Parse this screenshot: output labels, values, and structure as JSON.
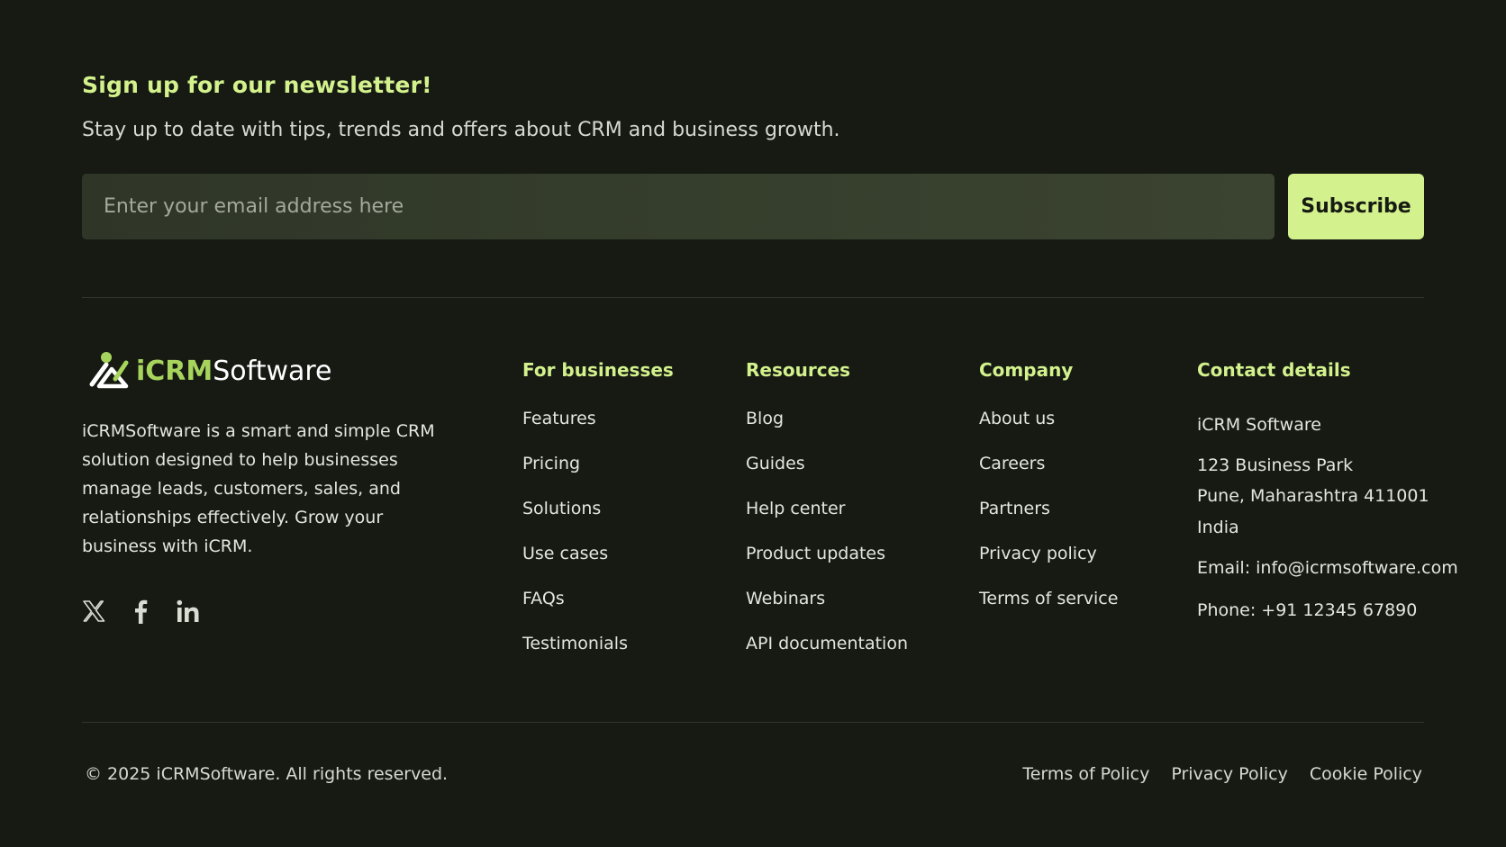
{
  "newsletter": {
    "title": "Sign up for our newsletter!",
    "subtitle": "Stay up to date with tips, trends and offers about CRM and business growth.",
    "email_placeholder": "Enter your email address here",
    "email_value": "",
    "subscribe_label": "Subscribe"
  },
  "brand": {
    "name_part1": "iCRM",
    "name_part2": "Software",
    "icon": "logo-mark-icon",
    "description": "iCRMSoftware is a smart and simple CRM solution designed to help businesses manage leads, customers, sales, and relationships effectively. Grow your business with iCRM."
  },
  "social": [
    {
      "icon": "x-twitter-icon"
    },
    {
      "icon": "facebook-icon"
    },
    {
      "icon": "linkedin-icon"
    }
  ],
  "columns": {
    "businesses": {
      "title": "For businesses",
      "items": [
        "Features",
        "Pricing",
        "Solutions",
        "Use cases",
        "FAQs",
        "Testimonials"
      ]
    },
    "resources": {
      "title": "Resources",
      "items": [
        "Blog",
        "Guides",
        "Help center",
        "Product updates",
        "Webinars",
        "API documentation"
      ]
    },
    "company": {
      "title": "Company",
      "items": [
        "About us",
        "Careers",
        "Partners",
        "Privacy policy",
        "Terms of service"
      ]
    }
  },
  "contact": {
    "title": "Contact details",
    "name": "iCRM Software",
    "address_line1": "123 Business Park",
    "address_line2": "Pune, Maharashtra 411001",
    "address_line3": "India",
    "email": "Email: info@icrmsoftware.com",
    "phone": "Phone: +91 12345 67890"
  },
  "footer": {
    "copyright": "© 2025 iCRMSoftware. All rights reserved.",
    "links": [
      "Terms of Policy",
      "Privacy Policy",
      "Cookie Policy"
    ]
  },
  "colors": {
    "background": "#161a13",
    "accent": "#d3f18c",
    "brand_green": "#a7d45c"
  }
}
